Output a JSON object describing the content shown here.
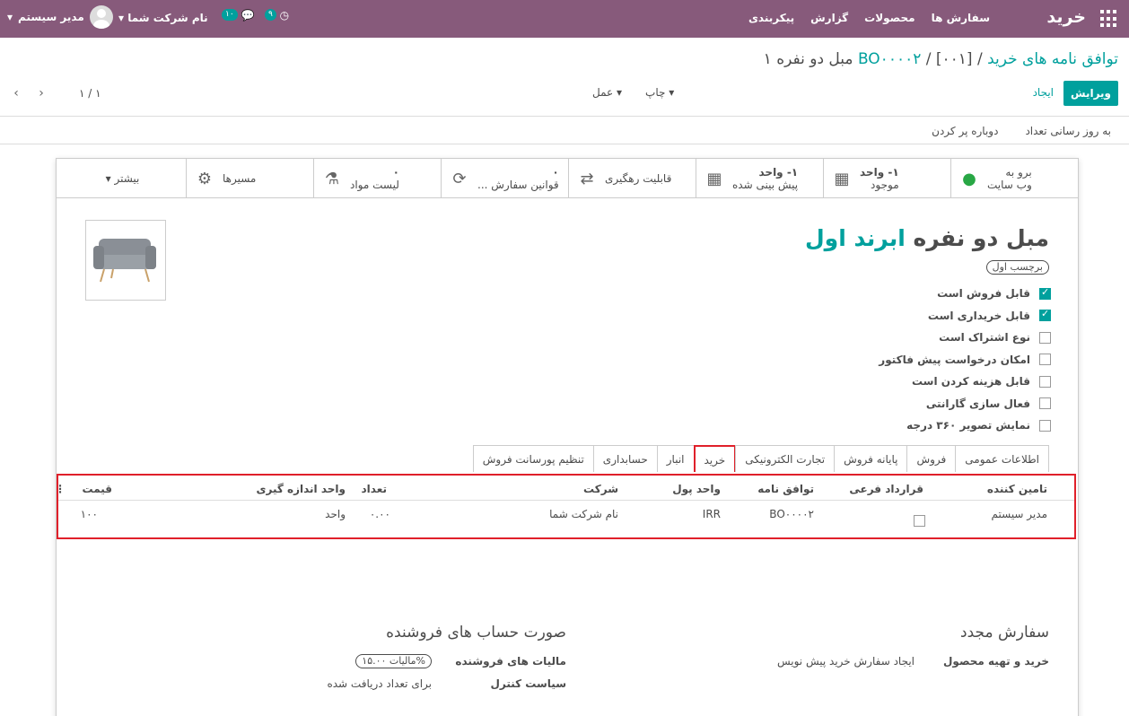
{
  "navbar": {
    "brand": "خرید",
    "menu": [
      "سفارش ها",
      "محصولات",
      "گزارش",
      "پیکربندی"
    ],
    "user": "مدیر سیستم",
    "company": "نام شرکت شما",
    "chat_count": "۱۰",
    "activity_count": "۹",
    "color": "#875a7b"
  },
  "breadcrumb": {
    "root": "توافق نامه های خرید",
    "agreement": "BO۰۰۰۰۲",
    "current": "[۰۰۱] مبل دو نفره ۱"
  },
  "toolbar": {
    "edit": "ویرایش",
    "create": "ایجاد",
    "print": "چاپ",
    "action": "عمل",
    "pager": "۱ / ۱"
  },
  "header_buttons": [
    "به روز رسانی تعداد",
    "دوباره پر کردن"
  ],
  "smart_buttons": [
    {
      "icon": "globe-icon",
      "line1": "برو به",
      "line2": "وب سایت"
    },
    {
      "icon": "cubes-icon",
      "line1": "۱- واحد",
      "line2": "موجود"
    },
    {
      "icon": "cubes-icon",
      "line1": "۱- واحد",
      "line2": "پیش بینی شده"
    },
    {
      "icon": "exchange-icon",
      "line1": "",
      "line2": "قابلیت رهگیری"
    },
    {
      "icon": "refresh-icon",
      "line1": "۰",
      "line2": "قوانین سفارش ..."
    },
    {
      "icon": "flask-icon",
      "line1": "۰",
      "line2": "لیست مواد"
    },
    {
      "icon": "cogs-icon",
      "line1": "",
      "line2": "مسیرها"
    },
    {
      "icon": "caret-icon",
      "line1": "",
      "line2": "بیشتر"
    }
  ],
  "product": {
    "name": "مبل دو نفره",
    "brand": "ابرند اول",
    "tag": "برچسب اول"
  },
  "checkboxes": [
    {
      "label": "قابل فروش است",
      "checked": true
    },
    {
      "label": "قابل خریداری است",
      "checked": true
    },
    {
      "label": "نوع اشتراک است",
      "checked": false
    },
    {
      "label": "امکان درخواست پیش فاکتور",
      "checked": false
    },
    {
      "label": "قابل هزینه کردن است",
      "checked": false
    },
    {
      "label": "فعال سازی گارانتی",
      "checked": false
    },
    {
      "label": "نمایش تصویر ۳۶۰ درجه",
      "checked": false
    }
  ],
  "tabs": [
    "اطلاعات عمومی",
    "فروش",
    "پایانه فروش",
    "تجارت الکترونیکی",
    "خرید",
    "انبار",
    "حسابداری",
    "تنظیم پورسانت فروش"
  ],
  "active_tab": "خرید",
  "table": {
    "headers": [
      "تامین کننده",
      "قرارداد فرعی",
      "توافق نامه",
      "واحد پول",
      "شرکت",
      "تعداد",
      "واحد اندازه گیری",
      "قیمت"
    ],
    "row": {
      "vendor": "مدیر سیستم",
      "agreement": "BO۰۰۰۰۲",
      "currency": "IRR",
      "company": "نام شرکت شما",
      "qty": "۰.۰۰",
      "uom": "واحد",
      "price": "۱۰۰"
    }
  },
  "reorder": {
    "title": "سفارش مجدد",
    "label": "خرید و تهیه محصول",
    "value": "ایجاد سفارش خرید پیش نویس"
  },
  "vendor_bills": {
    "title": "صورت حساب های فروشنده",
    "tax_label": "مالیات های فروشنده",
    "tax_value": "مالیات ۱۵.۰۰%",
    "control_label": "سیاست کنترل",
    "control_value": "برای تعداد دریافت شده"
  }
}
